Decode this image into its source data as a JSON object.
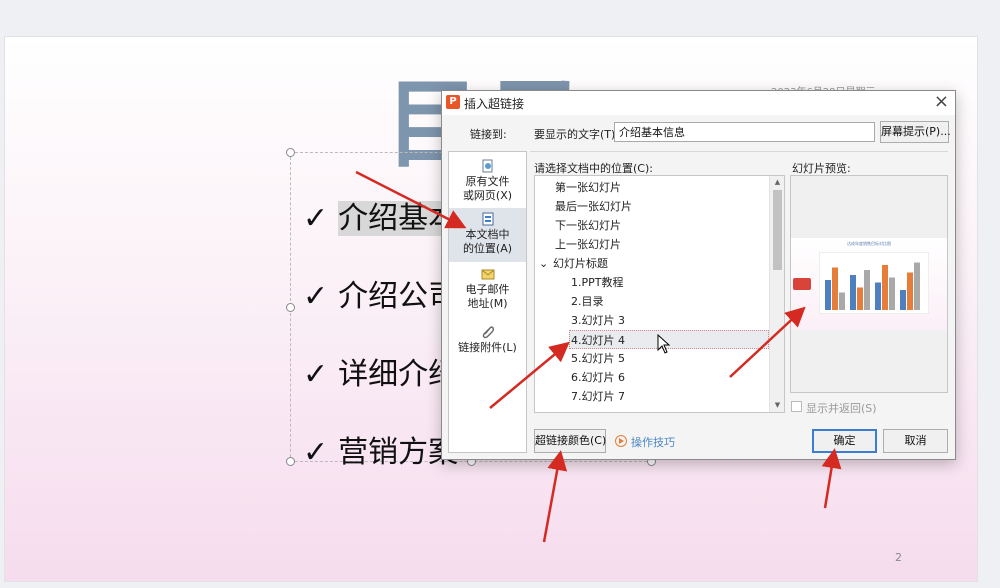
{
  "slide": {
    "title": "目录",
    "date": "2023年6月28日星期三",
    "page_number": "2",
    "bullets": [
      {
        "text": "介绍基本信息",
        "selected": true
      },
      {
        "text": "介绍公司"
      },
      {
        "text": "详细介绍"
      },
      {
        "text": "营销方案"
      }
    ],
    "check_glyph": "✓"
  },
  "dialog": {
    "logo": "P",
    "title": "插入超链接",
    "close": "×",
    "link_to_label": "链接到:",
    "display_text_label": "要显示的文字(T):",
    "display_text_value": "介绍基本信息",
    "screen_tip_button": "屏幕提示(P)...",
    "location_label": "请选择文档中的位置(C):",
    "preview_label": "幻灯片预览:",
    "sidebar": [
      {
        "line1": "原有文件",
        "line2": "或网页(X)",
        "icon": "globe-file-icon"
      },
      {
        "line1": "本文档中",
        "line2": "的位置(A)",
        "icon": "document-place-icon",
        "active": true
      },
      {
        "line1": "电子邮件",
        "line2": "地址(M)",
        "icon": "email-icon"
      },
      {
        "line1": "链接附件(L)",
        "line2": "",
        "icon": "paperclip-icon"
      }
    ],
    "locations": [
      {
        "label": "第一张幻灯片",
        "indent": 1
      },
      {
        "label": "最后一张幻灯片",
        "indent": 1
      },
      {
        "label": "下一张幻灯片",
        "indent": 1
      },
      {
        "label": "上一张幻灯片",
        "indent": 1
      },
      {
        "label": "幻灯片标题",
        "indent": 0,
        "expander": "⌄"
      },
      {
        "label": "1.PPT教程",
        "indent": 2
      },
      {
        "label": "2.目录",
        "indent": 2
      },
      {
        "label": "3.幻灯片 3",
        "indent": 2
      },
      {
        "label": "4.幻灯片 4",
        "indent": 2,
        "selected": true
      },
      {
        "label": "5.幻灯片 5",
        "indent": 2
      },
      {
        "label": "6.幻灯片 6",
        "indent": 2
      },
      {
        "label": "7.幻灯片 7",
        "indent": 2
      }
    ],
    "preview_slide_title": "达成年度销售目标对比图",
    "show_and_return": "显示并返回(S)",
    "hyperlink_color_button": "超链接颜色(C)",
    "tips_link": "操作技巧",
    "ok_button": "确定",
    "cancel_button": "取消"
  },
  "colors": {
    "arrow": "#d42a22",
    "accent": "#4a86c5",
    "ok_border": "#3b7ed1",
    "logo": "#e8562a"
  },
  "preview_chart": {
    "series_colors": [
      "#4e7fbf",
      "#e67e3a",
      "#a9a9a9"
    ],
    "values": [
      [
        60,
        85,
        35
      ],
      [
        70,
        45,
        80
      ],
      [
        55,
        90,
        65
      ],
      [
        40,
        75,
        95
      ]
    ]
  }
}
